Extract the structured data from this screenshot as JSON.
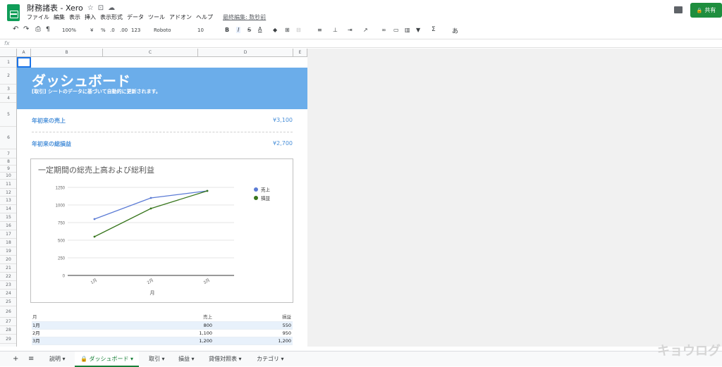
{
  "title": {
    "doc_name": "財務諸表 - Xero",
    "star": "☆",
    "folder": "⊡",
    "cloud": "☁"
  },
  "menu": [
    "ファイル",
    "編集",
    "表示",
    "挿入",
    "表示形式",
    "データ",
    "ツール",
    "アドオン",
    "ヘルプ"
  ],
  "last_edit": "最終編集: 数秒前",
  "share_label": "共有",
  "share_icon": "🔒",
  "toolbar": {
    "undo": "↶",
    "redo": "↷",
    "print": "⎙",
    "paint": "¶",
    "zoom": "100%",
    "currency": "¥",
    "percent": "%",
    "dec_less": ".0",
    "dec_more": ".00",
    "format": "123",
    "font": "Roboto",
    "size": "10",
    "bold": "B",
    "italic": "I",
    "strike": "S",
    "textcolor": "A",
    "more": "あ"
  },
  "fx": "fx",
  "columns": [
    "A",
    "B",
    "C",
    "D",
    "E"
  ],
  "rows": [
    "1",
    "2",
    "3",
    "4",
    "5",
    "6",
    "7",
    "8",
    "9",
    "10",
    "11",
    "12",
    "13",
    "14",
    "15",
    "16",
    "17",
    "18",
    "19",
    "20",
    "21",
    "22",
    "23",
    "24",
    "25",
    "26",
    "27",
    "28",
    "29"
  ],
  "dashboard": {
    "title": "ダッシュボード",
    "subtitle": "[取引] シートのデータに基づいて自動的に更新されます。",
    "kpi_sales_label": "年初来の売上",
    "kpi_sales_value": "¥3,100",
    "kpi_profit_label": "年初来の総損益",
    "kpi_profit_value": "¥2,700"
  },
  "chart_data": {
    "type": "line",
    "title": "一定期間の総売上高および総利益",
    "xlabel": "月",
    "ylabel": "",
    "categories": [
      "1月",
      "2月",
      "3月"
    ],
    "ylim": [
      0,
      1250
    ],
    "yticks": [
      0,
      250,
      500,
      750,
      1000,
      1250
    ],
    "grid": true,
    "legend": "right",
    "series": [
      {
        "name": "売上",
        "values": [
          800,
          1100,
          1200
        ],
        "color": "#5b7bd5"
      },
      {
        "name": "損益",
        "values": [
          550,
          950,
          1200
        ],
        "color": "#38761d"
      }
    ]
  },
  "table": {
    "headers": [
      "月",
      "売上",
      "損益"
    ],
    "rows": [
      [
        "1月",
        "800",
        "550"
      ],
      [
        "2月",
        "1,100",
        "950"
      ],
      [
        "3月",
        "1,200",
        "1,200"
      ]
    ]
  },
  "tabs": {
    "add": "+",
    "list": "≡",
    "items": [
      "説明",
      "ダッシュボード",
      "取引",
      "損益",
      "貸借対照表",
      "カテゴリ"
    ],
    "active": 1
  },
  "watermark": "キョウログ"
}
